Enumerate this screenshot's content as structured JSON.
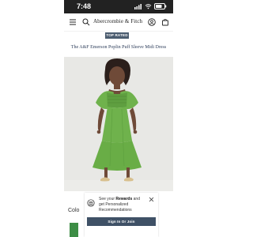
{
  "status_bar": {
    "time": "7:48"
  },
  "header": {
    "brand": "Abercrombie & Fitch",
    "icons": [
      "menu-icon",
      "search-icon",
      "account-icon",
      "bag-icon"
    ]
  },
  "product": {
    "badge": "TOP RATED",
    "title": "The A&F Emerson Poplin Puff Sleeve Midi Dress",
    "color_label": "Colo",
    "image_colors": {
      "background": "#e8e8e5",
      "dress": "#6fb24c",
      "skin": "#6f4a38",
      "hair": "#2b1f1b",
      "shoe": "#d8c08f"
    }
  },
  "rewards_popup": {
    "text_prefix": "See your ",
    "text_bold": "Rewards",
    "text_suffix": " and get Personalized Recommendations",
    "button_label": "Sign In Or Join"
  },
  "colors": {
    "status_bar": "#222222",
    "badge": "#4b5c6f",
    "title": "#2d3d5a",
    "button": "#3f5166",
    "swatch": "#3d8d45"
  }
}
